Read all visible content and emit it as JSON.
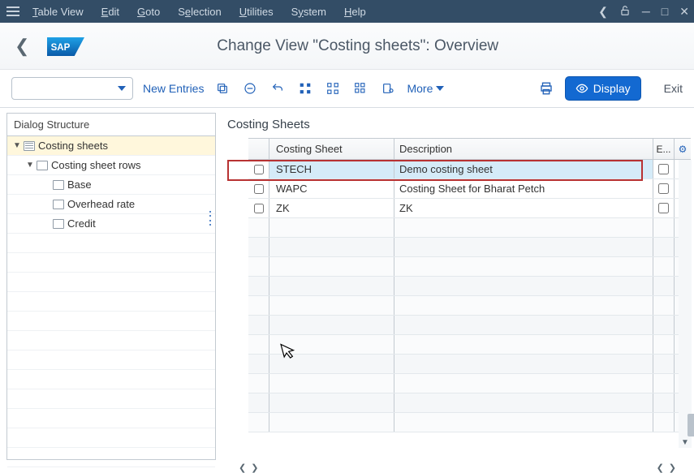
{
  "menubar": {
    "items": [
      "Table View",
      "Edit",
      "Goto",
      "Selection",
      "Utilities",
      "System",
      "Help"
    ]
  },
  "header": {
    "title": "Change View \"Costing sheets\": Overview"
  },
  "toolbar": {
    "new_entries": "New Entries",
    "more": "More",
    "display": "Display",
    "exit": "Exit"
  },
  "sidebar": {
    "title": "Dialog Structure",
    "tree": {
      "root": "Costing sheets",
      "child1": "Costing sheet rows",
      "leaf_base": "Base",
      "leaf_overhead": "Overhead rate",
      "leaf_credit": "Credit"
    }
  },
  "content": {
    "heading": "Costing Sheets",
    "columns": {
      "sheet": "Costing Sheet",
      "desc": "Description",
      "e": "E..."
    },
    "rows": [
      {
        "sheet": "STECH",
        "desc": "Demo costing sheet"
      },
      {
        "sheet": "WAPC",
        "desc": "Costing Sheet for Bharat Petch"
      },
      {
        "sheet": "ZK",
        "desc": "ZK"
      }
    ]
  }
}
